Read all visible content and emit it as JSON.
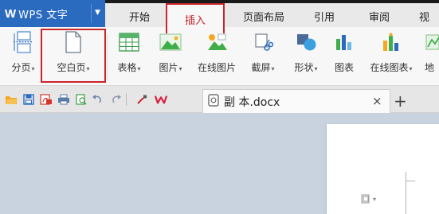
{
  "app": {
    "name": "WPS 文字",
    "logo": "W"
  },
  "menu_tabs": [
    {
      "label": "开始"
    },
    {
      "label": "插入",
      "active": true
    },
    {
      "label": "页面布局"
    },
    {
      "label": "引用"
    },
    {
      "label": "审阅"
    },
    {
      "label": "视"
    }
  ],
  "ribbon": {
    "buttons": [
      {
        "label": "分页",
        "icon": "page-break-icon",
        "dropdown": true
      },
      {
        "label": "空白页",
        "icon": "blank-page-icon",
        "dropdown": true,
        "highlighted": true
      },
      {
        "label": "表格",
        "icon": "table-icon",
        "dropdown": true
      },
      {
        "label": "图片",
        "icon": "picture-icon",
        "dropdown": true
      },
      {
        "label": "在线图片",
        "icon": "online-picture-icon"
      },
      {
        "label": "截屏",
        "icon": "screenshot-icon",
        "dropdown": true
      },
      {
        "label": "形状",
        "icon": "shapes-icon",
        "dropdown": true
      },
      {
        "label": "图表",
        "icon": "chart-icon"
      },
      {
        "label": "在线图表",
        "icon": "online-chart-icon",
        "dropdown": true
      },
      {
        "label": "地",
        "icon": "map-icon"
      }
    ],
    "dropdown_glyph": "▾"
  },
  "quick_access": [
    {
      "icon": "open-folder-icon"
    },
    {
      "icon": "save-icon"
    },
    {
      "icon": "export-pdf-icon"
    },
    {
      "icon": "print-icon"
    },
    {
      "icon": "print-preview-icon"
    },
    {
      "icon": "undo-icon"
    },
    {
      "icon": "redo-icon"
    },
    {
      "icon": "format-painter-icon"
    },
    {
      "icon": "wps-logo-icon"
    }
  ],
  "document_tab": {
    "title": "副 本.docx",
    "close_glyph": "×",
    "new_tab_glyph": "+"
  },
  "colors": {
    "app_blue": "#2a6bc0",
    "highlight_red": "#c8262b",
    "workspace": "#c9d3df"
  }
}
